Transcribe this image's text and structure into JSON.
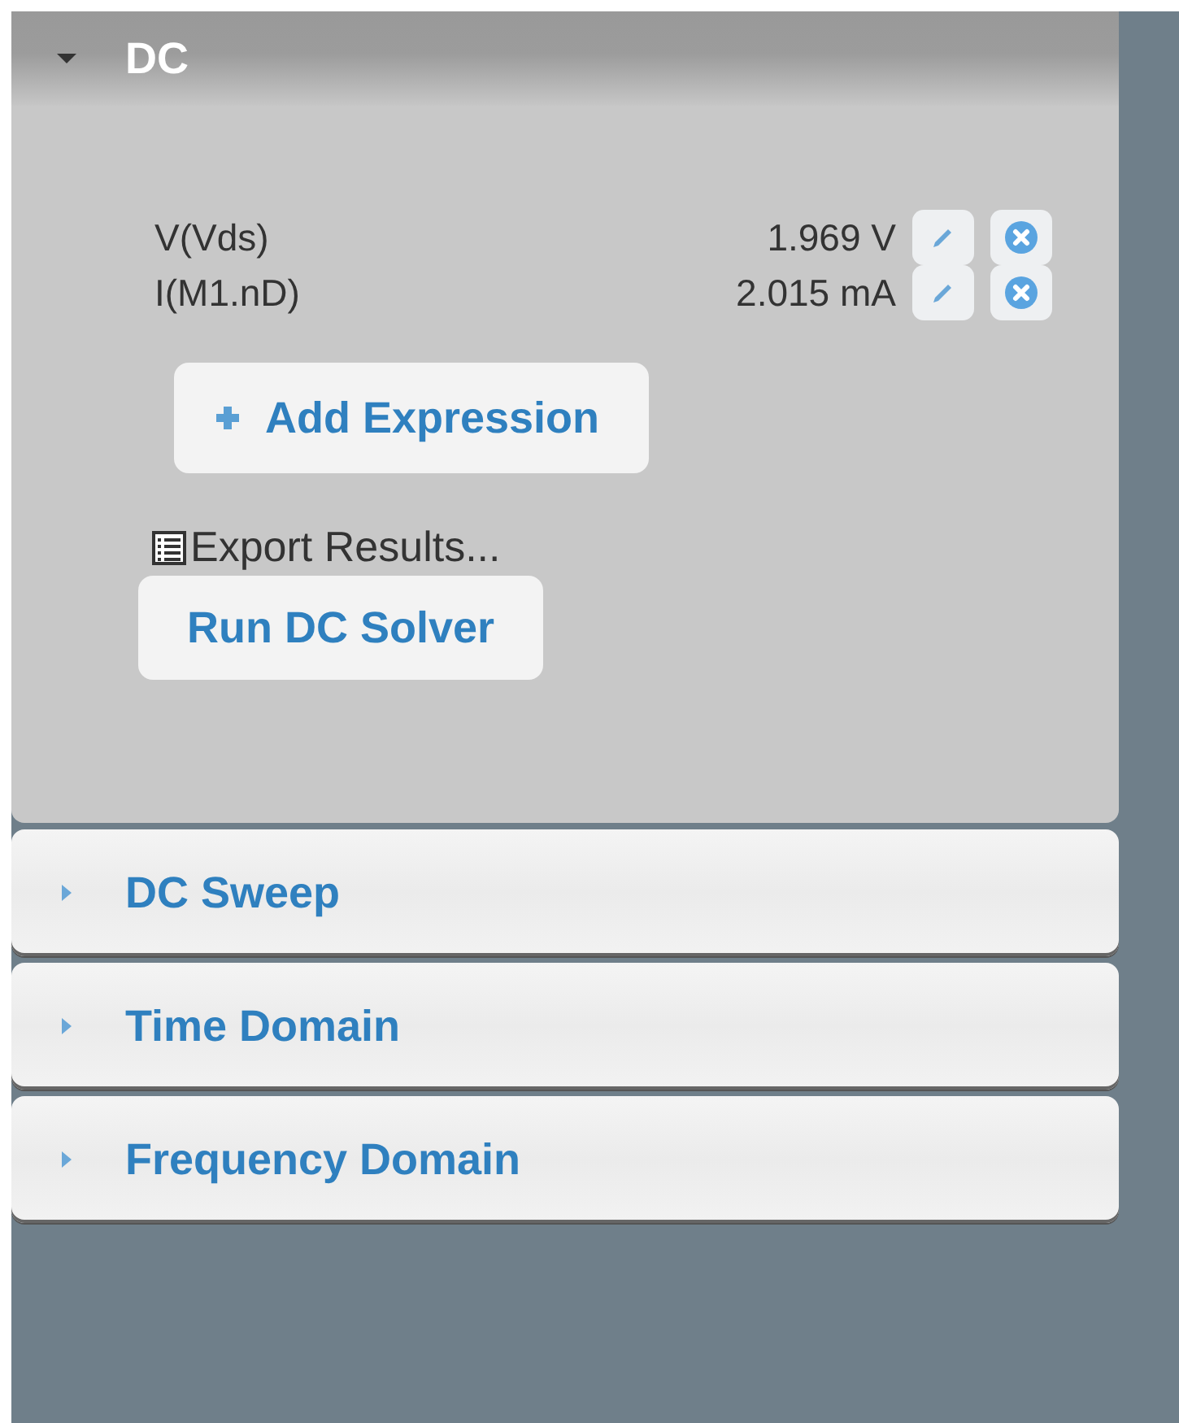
{
  "sections": [
    {
      "title": "DC",
      "expanded": true,
      "expressions": [
        {
          "name": "V(Vds)",
          "value": "1.969 V"
        },
        {
          "name": "I(M1.nD)",
          "value": "2.015 mA"
        }
      ],
      "add_button": "Add Expression",
      "export_link": "Export Results...",
      "run_button": "Run DC Solver"
    },
    {
      "title": "DC Sweep",
      "expanded": false
    },
    {
      "title": "Time Domain",
      "expanded": false
    },
    {
      "title": "Frequency Domain",
      "expanded": false
    }
  ]
}
